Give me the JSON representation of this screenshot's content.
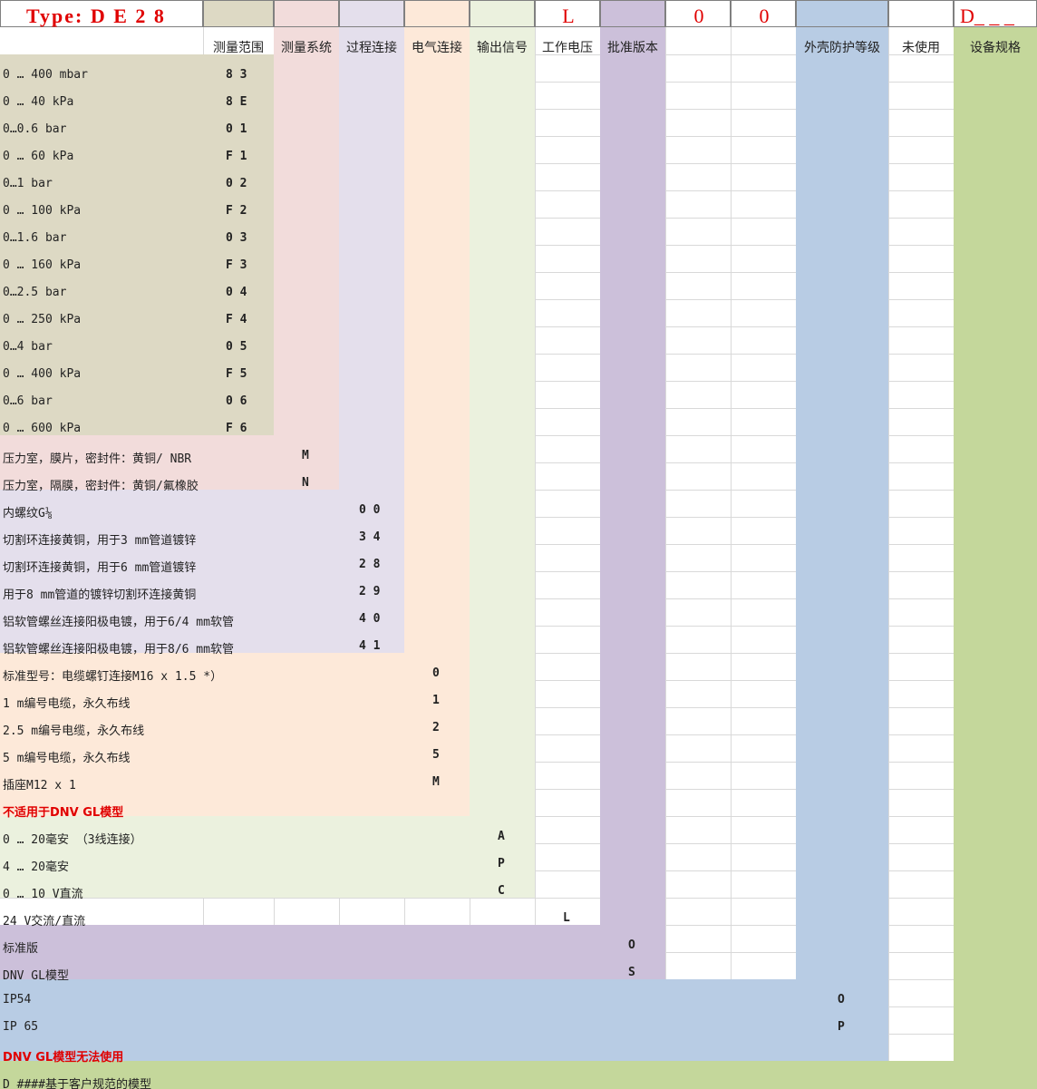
{
  "header": {
    "type_label": "Type: D E 2 8",
    "code_L": "L",
    "code_0a": "0",
    "code_0b": "0",
    "code_D": "D_ _ _"
  },
  "columns": {
    "range": "测量范围",
    "system": "测量系统",
    "process": "过程连接",
    "electrical": "电气连接",
    "output": "输出信号",
    "voltage": "工作电压",
    "version": "批准版本",
    "protection": "外壳防护等级",
    "unused": "未使用",
    "spec": "设备规格"
  },
  "rows": [
    {
      "label": "0 … 400 mbar",
      "code": "8 3"
    },
    {
      "label": "0 … 40 kPa",
      "code": "8 E"
    },
    {
      "label": "0…0.6 bar",
      "code": "0 1"
    },
    {
      "label": "0 … 60 kPa",
      "code": "F 1"
    },
    {
      "label": "0…1 bar",
      "code": "0 2"
    },
    {
      "label": "0 … 100 kPa",
      "code": "F 2"
    },
    {
      "label": "0…1.6 bar",
      "code": "0 3"
    },
    {
      "label": "0 … 160 kPa",
      "code": "F 3"
    },
    {
      "label": "0…2.5 bar",
      "code": "0 4"
    },
    {
      "label": "0 … 250 kPa",
      "code": "F 4"
    },
    {
      "label": "0…4 bar",
      "code": "0 5"
    },
    {
      "label": "0 … 400 kPa",
      "code": "F 5"
    },
    {
      "label": "0…6 bar",
      "code": "0 6"
    },
    {
      "label": "0 … 600 kPa",
      "code": "F 6"
    },
    {
      "label": "压力室，膜片，密封件：黄铜/ NBR",
      "code": "M"
    },
    {
      "label": "压力室，隔膜，密封件：黄铜/氟橡胶",
      "code": "N"
    },
    {
      "label": "内螺纹G⅛",
      "code": "0 0"
    },
    {
      "label": "切割环连接黄铜，用于3 mm管道镀锌",
      "code": "3 4"
    },
    {
      "label": "切割环连接黄铜，用于6 mm管道镀锌",
      "code": "2 8"
    },
    {
      "label": "用于8 mm管道的镀锌切割环连接黄铜",
      "code": "2 9"
    },
    {
      "label": "铝软管螺丝连接阳极电镀，用于6/4 mm软管",
      "code": "4 0"
    },
    {
      "label": "铝软管螺丝连接阳极电镀，用于8/6 mm软管",
      "code": "4 1"
    },
    {
      "label": "标准型号：电缆螺钉连接M16 x 1.5 *）",
      "code": "0"
    },
    {
      "label": "1 m编号电缆，永久布线",
      "code": "1"
    },
    {
      "label": "2.5 m编号电缆，永久布线",
      "code": "2"
    },
    {
      "label": "5 m编号电缆，永久布线",
      "code": "5"
    },
    {
      "label": "插座M12 x 1",
      "code": "M"
    },
    {
      "label": "不适用于DNV GL模型",
      "code": ""
    },
    {
      "label": "0 … 20毫安 （3线连接）",
      "code": "A"
    },
    {
      "label": "4 … 20毫安",
      "code": "P"
    },
    {
      "label": "0 … 10 V直流",
      "code": "C"
    },
    {
      "label": "24 V交流/直流",
      "code": "L"
    },
    {
      "label": "标准版",
      "code": "O"
    },
    {
      "label": "DNV GL模型",
      "code": "S"
    },
    {
      "label": "IP54",
      "code": "O"
    },
    {
      "label": "IP 65",
      "code": "P"
    },
    {
      "label": "DNV GL模型无法使用",
      "code": ""
    },
    {
      "label": "D ####基于客户规范的模型",
      "code": ""
    }
  ],
  "colors": {
    "range": "#ddd9c4",
    "system": "#f2dcdb",
    "process": "#e4dfec",
    "electrical": "#fde9d9",
    "output": "#ebf1de",
    "version": "#ccc0da",
    "protection": "#b8cce4",
    "spec": "#c4d79b",
    "accent": "#e00000"
  }
}
